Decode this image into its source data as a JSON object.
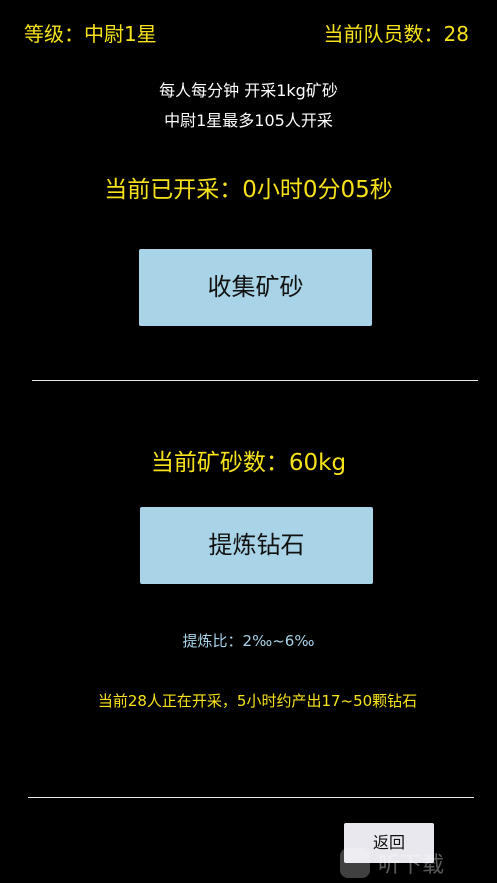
{
  "header": {
    "level_text": "等级：中尉1星",
    "member_text": "当前队员数：28"
  },
  "info": {
    "rate_text": "每人每分钟 开采1kg矿砂",
    "limit_text": "中尉1星最多105人开采"
  },
  "mining": {
    "elapsed_text": "当前已开采：0小时0分05秒",
    "collect_button": "收集矿砂"
  },
  "refine": {
    "ore_count_text": "当前矿砂数：60kg",
    "refine_button": "提炼钻石",
    "ratio_text": "提炼比：2‰~6‰",
    "forecast_text": "当前28人正在开采，5小时约产出17~50颗钻石"
  },
  "footer": {
    "back_button": "返回",
    "watermark_text": "听下载"
  },
  "colors": {
    "background": "#000000",
    "accent_yellow": "#f5e21b",
    "button_blue": "#a9d3e6"
  }
}
